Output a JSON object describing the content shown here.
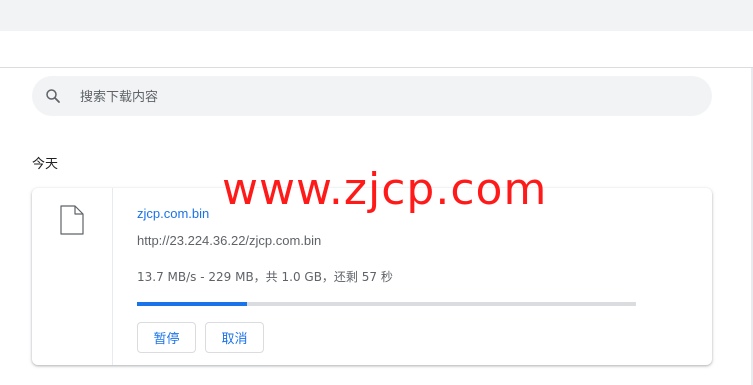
{
  "search": {
    "placeholder": "搜索下载内容",
    "icon": "search-icon"
  },
  "downloads": {
    "date_group": "今天",
    "item": {
      "icon": "file-icon",
      "file_name": "zjcp.com.bin",
      "url": "http://23.224.36.22/zjcp.com.bin",
      "status": "13.7 MB/s - 229 MB，共 1.0 GB，还剩 57 秒",
      "progress_fraction": 0.22,
      "pause_label": "暂停",
      "cancel_label": "取消"
    }
  },
  "watermark": {
    "text": "www.zjcp.com"
  },
  "colors": {
    "accent": "#1a73e8",
    "watermark": "#ff1a1a",
    "search_bg": "#f1f3f4"
  }
}
